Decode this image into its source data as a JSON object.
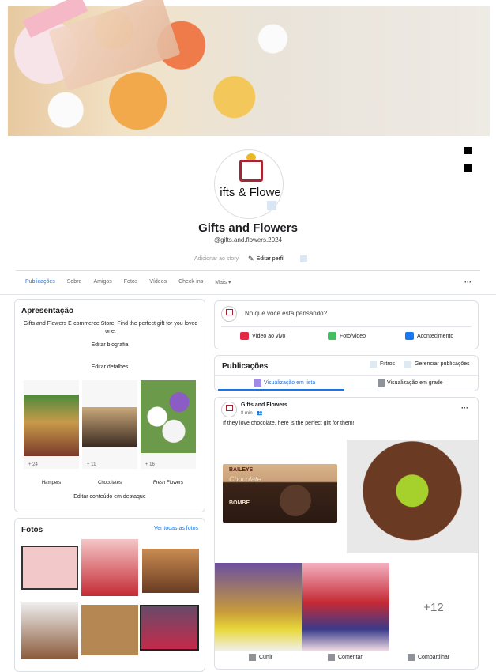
{
  "profile": {
    "name": "Gifts and Flowers",
    "handle": "@gifts.and.flowers.2024",
    "avatar_text": "ifts & Flowe",
    "add_story": "Adicionar ao story",
    "edit_profile": "Editar perfil"
  },
  "tabs": [
    "Publicações",
    "Sobre",
    "Amigos",
    "Fotos",
    "Vídeos",
    "Check-ins",
    "Mais"
  ],
  "tabs_more_icon": "chevron-down-icon",
  "intro": {
    "title": "Apresentação",
    "bio": "Gifts and Flowers E-commerce Store! Find the perfect gift for you loved one.",
    "edit_bio": "Editar biografia",
    "edit_details": "Editar detalhes",
    "featured": [
      {
        "count": "+ 24",
        "label": "Hampers"
      },
      {
        "count": "+ 11",
        "label": "Chocolates"
      },
      {
        "count": "+ 16",
        "label": "Fresh Flowers"
      }
    ],
    "edit_featured": "Editar conteúdo em destaque"
  },
  "photos": {
    "title": "Fotos",
    "see_all": "Ver todas as fotos"
  },
  "composer": {
    "placeholder": "No que você está pensando?",
    "live": "Vídeo ao vivo",
    "photo": "Foto/vídeo",
    "event": "Acontecimento"
  },
  "posts_header": {
    "title": "Publicações",
    "filters": "Filtros",
    "manage": "Gerenciar publicações",
    "list_view": "Visualização em lista",
    "grid_view": "Visualização em grade"
  },
  "post": {
    "author": "Gifts and Flowers",
    "time": "8 min",
    "text": "If they love chocolate, here is the perfect gift for them!",
    "chocolate_brand": "BAILEYS",
    "chocolate_name": "Chocolate",
    "chocolate_sub": "BOMBE",
    "more_count": "+12",
    "like": "Curtir",
    "comment": "Comentar",
    "share": "Compartilhar"
  },
  "colors": {
    "accent": "#1b74e4",
    "live_red": "#e42645",
    "photo_green": "#45bd62",
    "event_blue": "#1877f2",
    "brand_red": "#a32634"
  }
}
